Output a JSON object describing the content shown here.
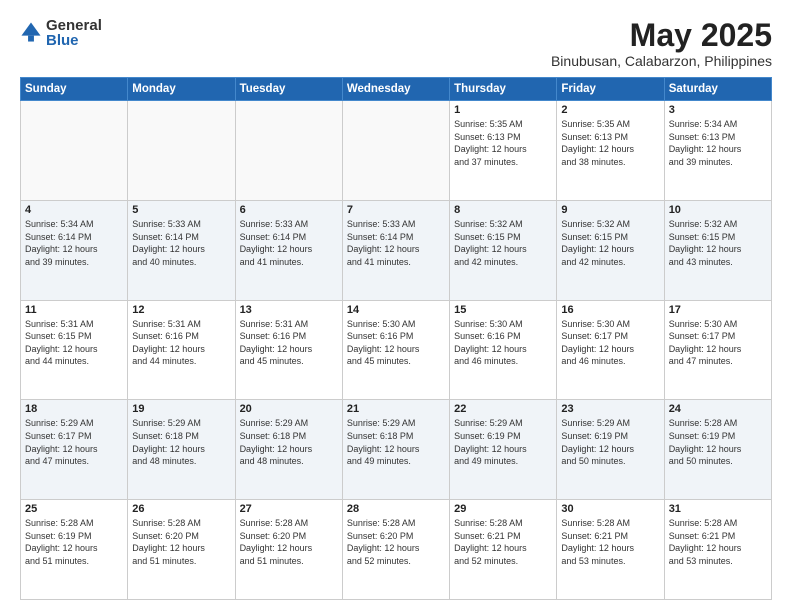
{
  "logo": {
    "general": "General",
    "blue": "Blue"
  },
  "header": {
    "month": "May 2025",
    "location": "Binubusan, Calabarzon, Philippines"
  },
  "weekdays": [
    "Sunday",
    "Monday",
    "Tuesday",
    "Wednesday",
    "Thursday",
    "Friday",
    "Saturday"
  ],
  "weeks": [
    [
      {
        "day": "",
        "info": ""
      },
      {
        "day": "",
        "info": ""
      },
      {
        "day": "",
        "info": ""
      },
      {
        "day": "",
        "info": ""
      },
      {
        "day": "1",
        "info": "Sunrise: 5:35 AM\nSunset: 6:13 PM\nDaylight: 12 hours\nand 37 minutes."
      },
      {
        "day": "2",
        "info": "Sunrise: 5:35 AM\nSunset: 6:13 PM\nDaylight: 12 hours\nand 38 minutes."
      },
      {
        "day": "3",
        "info": "Sunrise: 5:34 AM\nSunset: 6:13 PM\nDaylight: 12 hours\nand 39 minutes."
      }
    ],
    [
      {
        "day": "4",
        "info": "Sunrise: 5:34 AM\nSunset: 6:14 PM\nDaylight: 12 hours\nand 39 minutes."
      },
      {
        "day": "5",
        "info": "Sunrise: 5:33 AM\nSunset: 6:14 PM\nDaylight: 12 hours\nand 40 minutes."
      },
      {
        "day": "6",
        "info": "Sunrise: 5:33 AM\nSunset: 6:14 PM\nDaylight: 12 hours\nand 41 minutes."
      },
      {
        "day": "7",
        "info": "Sunrise: 5:33 AM\nSunset: 6:14 PM\nDaylight: 12 hours\nand 41 minutes."
      },
      {
        "day": "8",
        "info": "Sunrise: 5:32 AM\nSunset: 6:15 PM\nDaylight: 12 hours\nand 42 minutes."
      },
      {
        "day": "9",
        "info": "Sunrise: 5:32 AM\nSunset: 6:15 PM\nDaylight: 12 hours\nand 42 minutes."
      },
      {
        "day": "10",
        "info": "Sunrise: 5:32 AM\nSunset: 6:15 PM\nDaylight: 12 hours\nand 43 minutes."
      }
    ],
    [
      {
        "day": "11",
        "info": "Sunrise: 5:31 AM\nSunset: 6:15 PM\nDaylight: 12 hours\nand 44 minutes."
      },
      {
        "day": "12",
        "info": "Sunrise: 5:31 AM\nSunset: 6:16 PM\nDaylight: 12 hours\nand 44 minutes."
      },
      {
        "day": "13",
        "info": "Sunrise: 5:31 AM\nSunset: 6:16 PM\nDaylight: 12 hours\nand 45 minutes."
      },
      {
        "day": "14",
        "info": "Sunrise: 5:30 AM\nSunset: 6:16 PM\nDaylight: 12 hours\nand 45 minutes."
      },
      {
        "day": "15",
        "info": "Sunrise: 5:30 AM\nSunset: 6:16 PM\nDaylight: 12 hours\nand 46 minutes."
      },
      {
        "day": "16",
        "info": "Sunrise: 5:30 AM\nSunset: 6:17 PM\nDaylight: 12 hours\nand 46 minutes."
      },
      {
        "day": "17",
        "info": "Sunrise: 5:30 AM\nSunset: 6:17 PM\nDaylight: 12 hours\nand 47 minutes."
      }
    ],
    [
      {
        "day": "18",
        "info": "Sunrise: 5:29 AM\nSunset: 6:17 PM\nDaylight: 12 hours\nand 47 minutes."
      },
      {
        "day": "19",
        "info": "Sunrise: 5:29 AM\nSunset: 6:18 PM\nDaylight: 12 hours\nand 48 minutes."
      },
      {
        "day": "20",
        "info": "Sunrise: 5:29 AM\nSunset: 6:18 PM\nDaylight: 12 hours\nand 48 minutes."
      },
      {
        "day": "21",
        "info": "Sunrise: 5:29 AM\nSunset: 6:18 PM\nDaylight: 12 hours\nand 49 minutes."
      },
      {
        "day": "22",
        "info": "Sunrise: 5:29 AM\nSunset: 6:19 PM\nDaylight: 12 hours\nand 49 minutes."
      },
      {
        "day": "23",
        "info": "Sunrise: 5:29 AM\nSunset: 6:19 PM\nDaylight: 12 hours\nand 50 minutes."
      },
      {
        "day": "24",
        "info": "Sunrise: 5:28 AM\nSunset: 6:19 PM\nDaylight: 12 hours\nand 50 minutes."
      }
    ],
    [
      {
        "day": "25",
        "info": "Sunrise: 5:28 AM\nSunset: 6:19 PM\nDaylight: 12 hours\nand 51 minutes."
      },
      {
        "day": "26",
        "info": "Sunrise: 5:28 AM\nSunset: 6:20 PM\nDaylight: 12 hours\nand 51 minutes."
      },
      {
        "day": "27",
        "info": "Sunrise: 5:28 AM\nSunset: 6:20 PM\nDaylight: 12 hours\nand 51 minutes."
      },
      {
        "day": "28",
        "info": "Sunrise: 5:28 AM\nSunset: 6:20 PM\nDaylight: 12 hours\nand 52 minutes."
      },
      {
        "day": "29",
        "info": "Sunrise: 5:28 AM\nSunset: 6:21 PM\nDaylight: 12 hours\nand 52 minutes."
      },
      {
        "day": "30",
        "info": "Sunrise: 5:28 AM\nSunset: 6:21 PM\nDaylight: 12 hours\nand 53 minutes."
      },
      {
        "day": "31",
        "info": "Sunrise: 5:28 AM\nSunset: 6:21 PM\nDaylight: 12 hours\nand 53 minutes."
      }
    ]
  ]
}
